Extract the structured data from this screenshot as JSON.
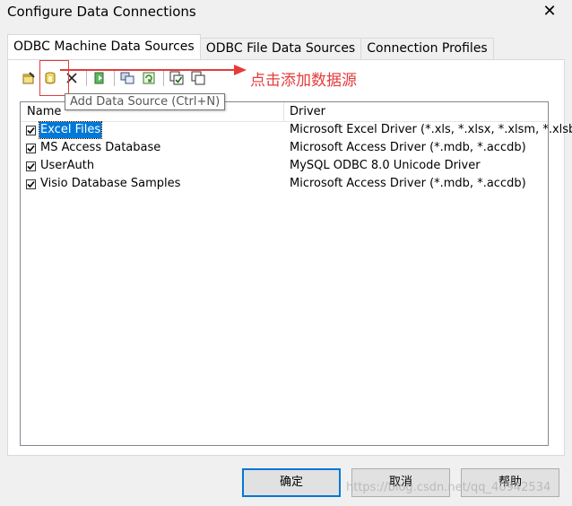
{
  "window": {
    "title": "Configure Data Connections",
    "close_glyph": "✕"
  },
  "tabs": [
    {
      "label": "ODBC Machine Data Sources",
      "active": true
    },
    {
      "label": "ODBC File Data Sources",
      "active": false
    },
    {
      "label": "Connection Profiles",
      "active": false
    }
  ],
  "toolbar": {
    "buttons": [
      {
        "icon": "edit-data-source-icon"
      },
      {
        "icon": "add-data-source-icon"
      },
      {
        "icon": "delete-icon"
      },
      {
        "icon": "test-connection-icon"
      },
      {
        "icon": "import-icon"
      },
      {
        "icon": "refresh-icon"
      },
      {
        "icon": "select-all-icon"
      },
      {
        "icon": "copy-icon"
      }
    ],
    "tooltip": "Add Data Source (Ctrl+N)"
  },
  "annotation": {
    "text": "点击添加数据源",
    "color": "#e53b3b"
  },
  "listview": {
    "columns": [
      "Name",
      "Driver"
    ],
    "rows": [
      {
        "name": "Excel Files",
        "driver": "Microsoft Excel Driver (*.xls, *.xlsx, *.xlsm, *.xlsb)",
        "checked": true,
        "selected": true
      },
      {
        "name": "MS Access Database",
        "driver": "Microsoft Access Driver (*.mdb, *.accdb)",
        "checked": true,
        "selected": false
      },
      {
        "name": "UserAuth",
        "driver": "MySQL ODBC 8.0 Unicode Driver",
        "checked": true,
        "selected": false
      },
      {
        "name": "Visio Database Samples",
        "driver": "Microsoft Access Driver (*.mdb, *.accdb)",
        "checked": true,
        "selected": false
      }
    ]
  },
  "footer": {
    "ok_label": "确定",
    "cancel_label": "取消",
    "help_label": "帮助"
  },
  "watermark": "https://blog.csdn.net/qq_40942534",
  "colors": {
    "selection": "#0078d7",
    "accent_red": "#e53b3b"
  }
}
